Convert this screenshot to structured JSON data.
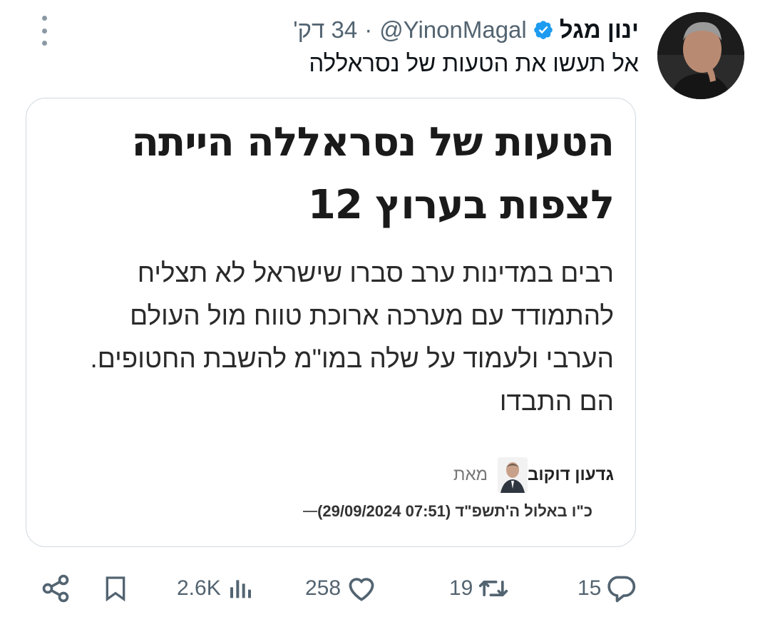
{
  "tweet": {
    "author_name": "ינון מגל",
    "handle": "@YinonMagal",
    "separator": "·",
    "time": "34 דק'",
    "text": "אל תעשו את הטעות של נסראללה",
    "verified": true
  },
  "card": {
    "headline_line1": "הטעות של נסראללה הייתה",
    "headline_line2": "לצפות בערוץ 12",
    "subtitle": "רבים במדינות ערב סברו שישראל לא תצליח להתמודד עם מערכה ארוכת טווח מול העולם הערבי ולעמוד על שלה במו\"מ להשבת החטופים. הם התבדו",
    "from_label": "מאת",
    "author": "גדעון דוקוב",
    "date": "כ\"ו באלול ה'תשפ\"ד (07:51 29/09/2024)"
  },
  "actions": {
    "replies": "15",
    "retweets": "19",
    "likes": "258",
    "views": "2.6K"
  },
  "colors": {
    "text": "#0f1419",
    "secondary": "#536471",
    "verified": "#1d9bf0",
    "border": "#cfd9de"
  }
}
